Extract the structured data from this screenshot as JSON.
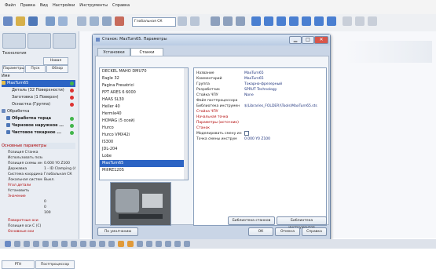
{
  "menu": [
    "Файл",
    "Правка",
    "Вид",
    "Настройки",
    "Инструменты",
    "Справка"
  ],
  "toolbar": {
    "combo_value": "Глобальная СК"
  },
  "left_panel": {
    "section_title": "Технология",
    "buttons": [
      "Новая",
      "Параметры",
      "Пуск",
      "Обзор"
    ],
    "tree": [
      {
        "label": "Имя",
        "type": "header"
      },
      {
        "label": "MaxTurn65",
        "selected": true
      },
      {
        "label": "Деталь (32 Поверхности)"
      },
      {
        "label": "Заготовка (1 Поверхн)"
      },
      {
        "label": "Оснастка (Группа)"
      },
      {
        "label": "Обработка"
      },
      {
        "label": "Обработка торца"
      },
      {
        "label": "Черновое наружное ..."
      },
      {
        "label": "Чистовое токарное ..."
      }
    ],
    "params_header": "Основные параметры",
    "params": [
      {
        "k": "Позиция Станка",
        "v": ""
      },
      {
        "k": "Использовать позицию",
        "v": ""
      },
      {
        "k": "Позиция схемы инструм.",
        "v": "0.000 Y0 Z100"
      },
      {
        "k": "Державка",
        "v": "1 - ID Clamping (4)"
      },
      {
        "k": "Система координат заг.",
        "v": "Глобальная СК"
      },
      {
        "k": "Локальная система коорд.",
        "v": "Выкл."
      },
      {
        "k": "Угол детали",
        "v": ""
      },
      {
        "k": "Установить",
        "v": ""
      },
      {
        "k": "Значение",
        "v": ""
      },
      {
        "k": "",
        "v": "0"
      },
      {
        "k": "",
        "v": "0"
      },
      {
        "k": "",
        "v": "100"
      },
      {
        "k": "Поворотные оси",
        "v": ""
      },
      {
        "k": "Позиция оси C (C)",
        "v": ""
      },
      {
        "k": "Основные оси",
        "v": ""
      }
    ],
    "bottom_tabs": [
      "PTH",
      "Постпроцессор"
    ]
  },
  "dialog": {
    "title": "Станок: MaxTurn65. Параметры",
    "tabs": [
      "Установки",
      "Станки"
    ],
    "machines": [
      "DECKEL MAHO DMU70",
      "Eagle 32",
      "Fagina Fresatrici",
      "FPT ARES 6 6000",
      "HAAS SL30",
      "Heller 40",
      "Hermle40",
      "HOMAG (5 осей)",
      "Hurco",
      "Hurco VMX42i",
      "IS300",
      "JDL-204",
      "Lobe",
      "MaxTurn65",
      "MillRE120S"
    ],
    "props": [
      {
        "k": "Название",
        "v": "MaxTurn65",
        "hdr": false
      },
      {
        "k": "Комментарий",
        "v": "MaxTurn65",
        "hdr": false
      },
      {
        "k": "Группа",
        "v": "Токарно-фрезерный",
        "hdr": false
      },
      {
        "k": "Разработчик",
        "v": "SPRUT Technology",
        "hdr": false
      },
      {
        "k": "Стойка ЧПУ",
        "v": "None",
        "hdr": false
      },
      {
        "k": "Файл постпроцессора",
        "v": "",
        "hdr": false
      },
      {
        "k": "Библиотека инструмен",
        "v": "$(Libraries_FOLDER)\\Tools\\MaxTurn65.sts",
        "hdr": false
      },
      {
        "k": "Стойка ЧПУ",
        "v": "",
        "hdr": true
      },
      {
        "k": "Начальная точка",
        "v": "",
        "hdr": true
      },
      {
        "k": "Параметры (источник)",
        "v": "",
        "hdr": true
      },
      {
        "k": "Станок",
        "v": "",
        "hdr": true
      },
      {
        "k": "Моделировать смену ин",
        "v": "",
        "hdr": false
      },
      {
        "k": "Точка смены инструм",
        "v": "0.000 Y0 Z100",
        "hdr": false
      }
    ],
    "buttons": {
      "default": "По умолчанию",
      "tool_lib": "Библиотека станков",
      "tool_lib2": "Библиотека инструментов",
      "ok": "ОК",
      "cancel": "Отмена",
      "help": "Справка"
    }
  }
}
